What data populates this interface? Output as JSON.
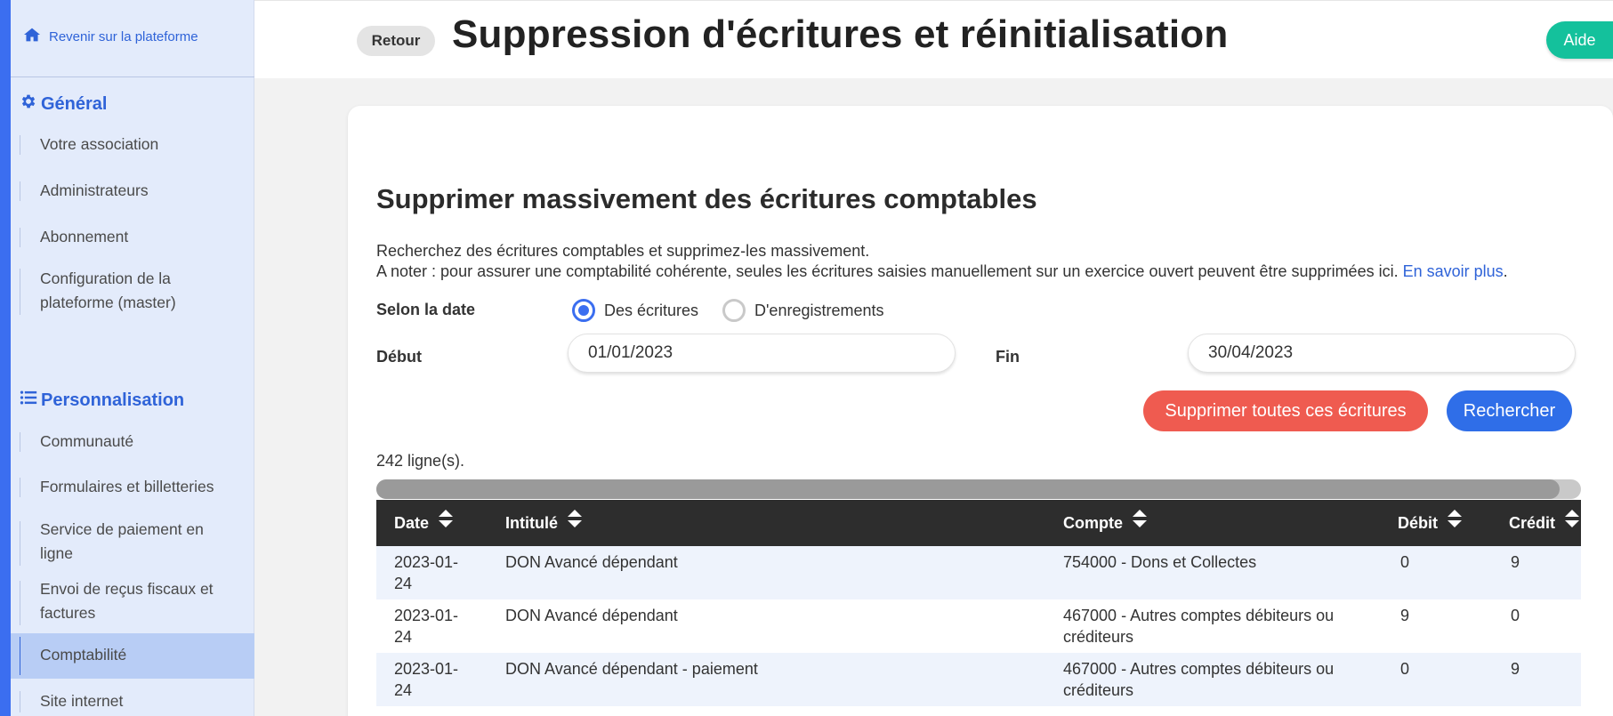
{
  "sidebar": {
    "back_link": "Revenir sur la plateforme",
    "sections": [
      {
        "title": "Général",
        "icon": "gear-icon"
      },
      {
        "title": "Personnalisation",
        "icon": "list-icon"
      }
    ],
    "general_items": [
      {
        "label": "Votre association"
      },
      {
        "label": "Administrateurs"
      },
      {
        "label": "Abonnement"
      },
      {
        "label": "Configuration de la plateforme (master)"
      }
    ],
    "perso_items": [
      {
        "label": "Communauté"
      },
      {
        "label": "Formulaires et billetteries"
      },
      {
        "label": "Service de paiement en ligne"
      },
      {
        "label": "Envoi de reçus fiscaux et factures"
      },
      {
        "label": "Comptabilité",
        "active": true
      },
      {
        "label": "Site internet"
      }
    ]
  },
  "header": {
    "back_button": "Retour",
    "title": "Suppression d'écritures et réinitialisation",
    "help_button": "Aide"
  },
  "main": {
    "title": "Supprimer massivement des écritures comptables",
    "desc_line1": "Recherchez des écritures comptables et supprimez-les massivement.",
    "desc_line2": "A noter : pour assurer une comptabilité cohérente, seules les écritures saisies manuellement sur un exercice ouvert peuvent être supprimées ici.",
    "learn_more": "En savoir plus",
    "date_by_label": "Selon la date",
    "radio_options": [
      {
        "label": "Des écritures",
        "selected": true
      },
      {
        "label": "D'enregistrements",
        "selected": false
      }
    ],
    "start_label": "Début",
    "start_value": "01/01/2023",
    "end_label": "Fin",
    "end_value": "30/04/2023",
    "delete_all_button": "Supprimer toutes ces écritures",
    "search_button": "Rechercher",
    "row_count": "242 ligne(s).",
    "table": {
      "columns": [
        "Date",
        "Intitulé",
        "Compte",
        "Débit",
        "Crédit"
      ],
      "rows": [
        {
          "date": "2023-01-24",
          "label": "DON Avancé dépendant",
          "account": "754000 - Dons et Collectes",
          "debit": "0",
          "credit": "9"
        },
        {
          "date": "2023-01-24",
          "label": "DON Avancé dépendant",
          "account": "467000 - Autres comptes débiteurs ou créditeurs",
          "debit": "9",
          "credit": "0"
        },
        {
          "date": "2023-01-24",
          "label": "DON Avancé dépendant - paiement",
          "account": "467000 - Autres comptes débiteurs ou créditeurs",
          "debit": "0",
          "credit": "9"
        }
      ]
    }
  },
  "colors": {
    "accent": "#3b6ef0",
    "danger": "#ef5b50",
    "help": "#14c19c",
    "table_header": "#2d2d2d"
  }
}
